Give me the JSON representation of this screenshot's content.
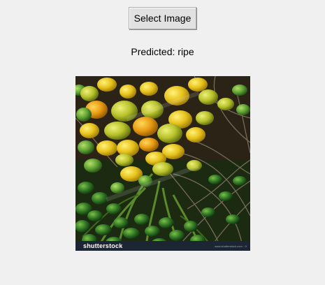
{
  "window": {
    "select_button_label": "Select Image",
    "prediction_text": "Predicted: ripe"
  },
  "preview": {
    "image_subject": "bunch of ripe and unripe areca palm nuts on branches",
    "watermark_logo": "shutterstock",
    "watermark_id": "www.shutterstock.com · 000000000"
  },
  "colors": {
    "window_bg": "#f0f0f0",
    "button_bg": "#e1e1e1",
    "button_border": "#adadad",
    "fruit_yellow": "#e8c21c",
    "fruit_green": "#5fa033",
    "watermark_bar": "#1c2533"
  }
}
